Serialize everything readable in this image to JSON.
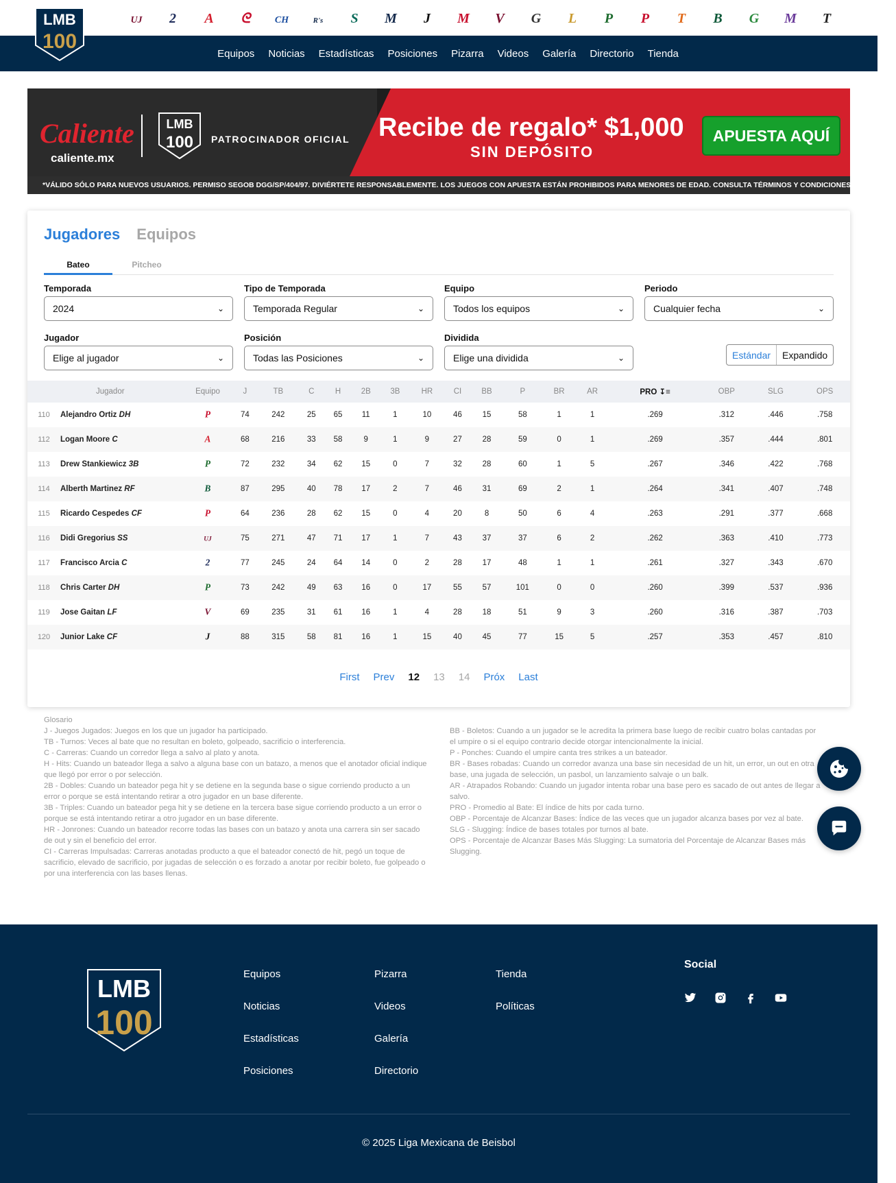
{
  "nav": {
    "links": [
      "Equipos",
      "Noticias",
      "Estadísticas",
      "Posiciones",
      "Pizarra",
      "Videos",
      "Galería",
      "Directorio",
      "Tienda"
    ]
  },
  "logo": {
    "text_top": "LMB",
    "text_bottom": "100"
  },
  "teams": [
    {
      "icon": "toros-icon",
      "glyph": "UJ",
      "color": "#7a1030"
    },
    {
      "icon": "dos-laredos-icon",
      "glyph": "2",
      "color": "#1d2b5a"
    },
    {
      "icon": "algodoneros-icon",
      "glyph": "A",
      "color": "#d41f2e"
    },
    {
      "icon": "olmecas-icon",
      "glyph": "ᘓ",
      "color": "#c8102e"
    },
    {
      "icon": "charros-icon",
      "glyph": "CH",
      "color": "#1c4fa0"
    },
    {
      "icon": "rieleros-icon",
      "glyph": "R's",
      "color": "#13294b"
    },
    {
      "icon": "saraperos-icon",
      "glyph": "S",
      "color": "#0a6b5a"
    },
    {
      "icon": "sultanes-icon",
      "glyph": "M",
      "color": "#13294b"
    },
    {
      "icon": "jaguares-icon",
      "glyph": "J",
      "color": "#111111"
    },
    {
      "icon": "diablos-icon",
      "glyph": "M",
      "color": "#c8102e"
    },
    {
      "icon": "acereros-icon",
      "glyph": "V",
      "color": "#7a1030"
    },
    {
      "icon": "guerreros-icon",
      "glyph": "G",
      "color": "#333333"
    },
    {
      "icon": "leones-icon",
      "glyph": "L",
      "color": "#c99a2e"
    },
    {
      "icon": "pericos-icon",
      "glyph": "P",
      "color": "#1d6b2e"
    },
    {
      "icon": "piratas-icon",
      "glyph": "P",
      "color": "#c8102e"
    },
    {
      "icon": "tigres-icon",
      "glyph": "T",
      "color": "#e06a1a"
    },
    {
      "icon": "bravos-icon",
      "glyph": "B",
      "color": "#0f5a3a"
    },
    {
      "icon": "generales-icon",
      "glyph": "G",
      "color": "#2c8a3e"
    },
    {
      "icon": "mariachis-icon",
      "glyph": "M",
      "color": "#6a3a9a"
    },
    {
      "icon": "tecolotes-icon",
      "glyph": "T",
      "color": "#222222"
    }
  ],
  "banner": {
    "brand": "Caliente",
    "brand_url": "caliente.mx",
    "sponsor": "PATROCINADOR OFICIAL",
    "promo_line1": "Recibe de regalo* $1,000",
    "promo_line2": "SIN DEPÓSITO",
    "cta": "APUESTA AQUÍ",
    "legal": "*VÁLIDO SÓLO PARA NUEVOS USUARIOS. PERMISO SEGOB DGG/SP/404/97. DIVIÉRTETE RESPONSABLEMENTE. LOS JUEGOS CON APUESTA ESTÁN PROHIBIDOS PARA MENORES DE EDAD. CONSULTA TÉRMINOS Y CONDICIONES EN CALIENTE.MX"
  },
  "tabs": {
    "players": "Jugadores",
    "teams": "Equipos",
    "batting": "Bateo",
    "pitching": "Pitcheo"
  },
  "filters": {
    "temporada": {
      "label": "Temporada",
      "value": "2024"
    },
    "tipo": {
      "label": "Tipo de Temporada",
      "value": "Temporada Regular"
    },
    "equipo": {
      "label": "Equipo",
      "value": "Todos los equipos"
    },
    "periodo": {
      "label": "Periodo",
      "value": "Cualquier fecha"
    },
    "jugador": {
      "label": "Jugador",
      "value": "Elige al jugador"
    },
    "posicion": {
      "label": "Posición",
      "value": "Todas las Posiciones"
    },
    "dividida": {
      "label": "Dividida",
      "value": "Elige una dividida"
    }
  },
  "view_toggle": {
    "standard": "Estándar",
    "expanded": "Expandido"
  },
  "table": {
    "headers": [
      "Jugador",
      "Equipo",
      "J",
      "TB",
      "C",
      "H",
      "2B",
      "3B",
      "HR",
      "CI",
      "BB",
      "P",
      "BR",
      "AR",
      "PRO",
      "OBP",
      "SLG",
      "OPS"
    ],
    "rows": [
      {
        "rank": "110",
        "name": "Alejandro Ortiz",
        "pos": "DH",
        "team_icon": "piratas-icon",
        "team_glyph": "P",
        "team_color": "#c8102e",
        "stats": [
          "74",
          "242",
          "25",
          "65",
          "11",
          "1",
          "10",
          "46",
          "15",
          "58",
          "1",
          "1",
          ".269",
          ".312",
          ".446",
          ".758"
        ]
      },
      {
        "rank": "112",
        "name": "Logan Moore",
        "pos": "C",
        "team_icon": "algodoneros-icon",
        "team_glyph": "A",
        "team_color": "#d41f2e",
        "stats": [
          "68",
          "216",
          "33",
          "58",
          "9",
          "1",
          "9",
          "27",
          "28",
          "59",
          "0",
          "1",
          ".269",
          ".357",
          ".444",
          ".801"
        ]
      },
      {
        "rank": "113",
        "name": "Drew Stankiewicz",
        "pos": "3B",
        "team_icon": "pericos-icon",
        "team_glyph": "P",
        "team_color": "#1d6b2e",
        "stats": [
          "72",
          "232",
          "34",
          "62",
          "15",
          "0",
          "7",
          "32",
          "28",
          "60",
          "1",
          "5",
          ".267",
          ".346",
          ".422",
          ".768"
        ]
      },
      {
        "rank": "114",
        "name": "Alberth Martinez",
        "pos": "RF",
        "team_icon": "bravos-icon",
        "team_glyph": "B",
        "team_color": "#0f5a3a",
        "stats": [
          "87",
          "295",
          "40",
          "78",
          "17",
          "2",
          "7",
          "46",
          "31",
          "69",
          "2",
          "1",
          ".264",
          ".341",
          ".407",
          ".748"
        ]
      },
      {
        "rank": "115",
        "name": "Ricardo Cespedes",
        "pos": "CF",
        "team_icon": "piratas-icon",
        "team_glyph": "P",
        "team_color": "#c8102e",
        "stats": [
          "64",
          "236",
          "28",
          "62",
          "15",
          "0",
          "4",
          "20",
          "8",
          "50",
          "6",
          "4",
          ".263",
          ".291",
          ".377",
          ".668"
        ]
      },
      {
        "rank": "116",
        "name": "Didi Gregorius",
        "pos": "SS",
        "team_icon": "toros-icon",
        "team_glyph": "UJ",
        "team_color": "#7a1030",
        "stats": [
          "75",
          "271",
          "47",
          "71",
          "17",
          "1",
          "7",
          "43",
          "37",
          "37",
          "6",
          "2",
          ".262",
          ".363",
          ".410",
          ".773"
        ]
      },
      {
        "rank": "117",
        "name": "Francisco Arcia",
        "pos": "C",
        "team_icon": "dos-laredos-icon",
        "team_glyph": "2",
        "team_color": "#1d2b5a",
        "stats": [
          "77",
          "245",
          "24",
          "64",
          "14",
          "0",
          "2",
          "28",
          "17",
          "48",
          "1",
          "1",
          ".261",
          ".327",
          ".343",
          ".670"
        ]
      },
      {
        "rank": "118",
        "name": "Chris Carter",
        "pos": "DH",
        "team_icon": "pericos-icon",
        "team_glyph": "P",
        "team_color": "#1d6b2e",
        "stats": [
          "73",
          "242",
          "49",
          "63",
          "16",
          "0",
          "17",
          "55",
          "57",
          "101",
          "0",
          "0",
          ".260",
          ".399",
          ".537",
          ".936"
        ]
      },
      {
        "rank": "119",
        "name": "Jose Gaitan",
        "pos": "LF",
        "team_icon": "acereros-icon",
        "team_glyph": "V",
        "team_color": "#7a1030",
        "stats": [
          "69",
          "235",
          "31",
          "61",
          "16",
          "1",
          "4",
          "28",
          "18",
          "51",
          "9",
          "3",
          ".260",
          ".316",
          ".387",
          ".703"
        ]
      },
      {
        "rank": "120",
        "name": "Junior Lake",
        "pos": "CF",
        "team_icon": "jaguares-icon",
        "team_glyph": "J",
        "team_color": "#111111",
        "stats": [
          "88",
          "315",
          "58",
          "81",
          "16",
          "1",
          "15",
          "40",
          "45",
          "77",
          "15",
          "5",
          ".257",
          ".353",
          ".457",
          ".810"
        ]
      }
    ]
  },
  "pager": {
    "first": "First",
    "prev": "Prev",
    "current": "12",
    "p13": "13",
    "p14": "14",
    "next": "Próx",
    "last": "Last"
  },
  "glossary": {
    "title": "Glosario",
    "left": [
      "J - Juegos Jugados: Juegos en los que un jugador ha participado.",
      "TB - Turnos: Veces al bate que no resultan en boleto, golpeado, sacrificio o interferencia.",
      "C - Carreras: Cuando un corredor llega a salvo al plato y anota.",
      "H - Hits: Cuando un bateador llega a salvo a alguna base con un batazo, a menos que el anotador oficial indique que llegó por error o por selección.",
      "2B - Dobles: Cuando un bateador pega hit y se detiene en la segunda base o sigue corriendo producto a un error o porque se está intentando retirar a otro jugador en un base diferente.",
      "3B - Triples: Cuando un bateador pega hit y se detiene en la tercera base sigue corriendo producto a un error o porque se está intentando retirar a otro jugador en un base diferente.",
      "HR - Jonrones: Cuando un bateador recorre todas las bases con un batazo y anota una carrera sin ser sacado de out y sin el beneficio del error.",
      "CI - Carreras Impulsadas: Carreras anotadas producto a que el bateador conectó de hit, pegó un toque de sacrificio, elevado de sacrificio, por jugadas de selección o es forzado a anotar por recibir boleto, fue golpeado o por una interferencia con las bases llenas."
    ],
    "right": [
      "BB - Boletos: Cuando a un jugador se le acredita la primera base luego de recibir cuatro bolas cantadas por el umpire o si el equipo contrario decide otorgar intencionalmente la inicial.",
      "P - Ponches: Cuando el umpire canta tres strikes a un bateador.",
      "BR - Bases robadas: Cuando un corredor avanza una base sin necesidad de un hit, un error, un out en otra base, una jugada de selección, un pasbol, un lanzamiento salvaje o un balk.",
      "AR - Atrapados Robando: Cuando un jugador intenta robar una base pero es sacado de out antes de llegar a salvo.",
      "PRO - Promedio al Bate: El índice de hits por cada turno.",
      "OBP - Porcentaje de Alcanzar Bases: Índice de las veces que un jugador alcanza bases por vez al bate.",
      "SLG - Slugging: Índice de bases totales por turnos al bate.",
      "OPS - Porcentaje de Alcanzar Bases Más Slugging: La sumatoria del Porcentaje de Alcanzar Bases más Slugging."
    ]
  },
  "footer": {
    "col1": [
      "Equipos",
      "Noticias",
      "Estadísticas",
      "Posiciones"
    ],
    "col2": [
      "Pizarra",
      "Videos",
      "Galería",
      "Directorio"
    ],
    "col3": [
      "Tienda",
      "Políticas"
    ],
    "social_title": "Social",
    "copyright": "© 2025 Liga Mexicana de Beisbol"
  },
  "colors": {
    "navy": "#02294a",
    "accent": "#2b7fd9",
    "gold": "#c9a04a"
  }
}
